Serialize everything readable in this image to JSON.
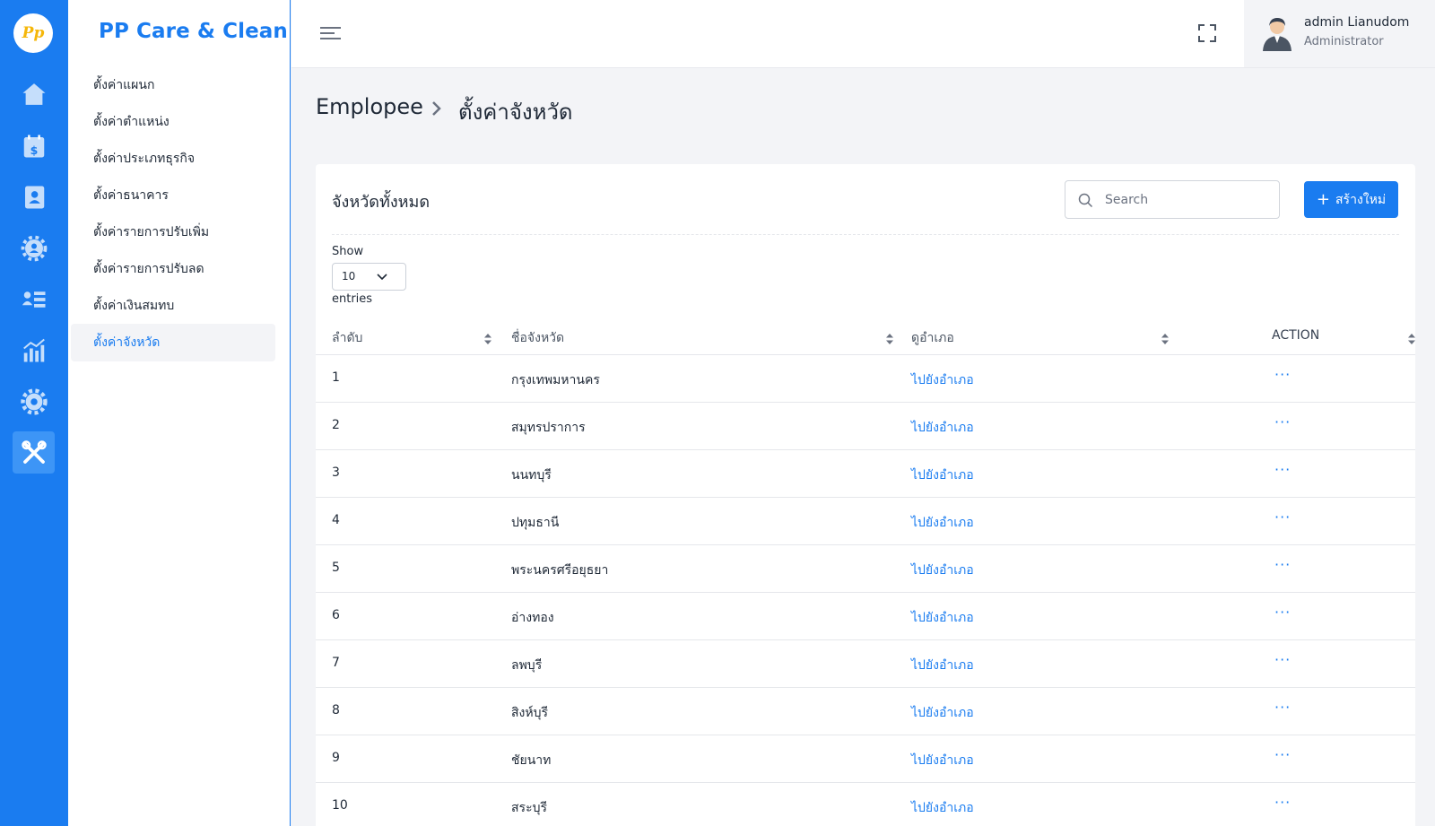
{
  "brand": {
    "logo_text": "Pp",
    "name": "PP Care & Clean"
  },
  "rail": {
    "icons": [
      "home-icon",
      "calendar-dollar-icon",
      "contact-book-icon",
      "team-gear-icon",
      "user-list-icon",
      "bar-chart-icon",
      "settings-gear-icon",
      "tools-icon"
    ],
    "active": "tools-icon"
  },
  "submenu": {
    "items": [
      {
        "label": "ตั้งค่าแผนก"
      },
      {
        "label": "ตั้งค่าตำแหน่ง"
      },
      {
        "label": "ตั้งค่าประเภทธุรกิจ"
      },
      {
        "label": "ตั้งค่าธนาคาร"
      },
      {
        "label": "ตั้งค่ารายการปรับเพิ่ม"
      },
      {
        "label": "ตั้งค่ารายการปรับลด"
      },
      {
        "label": "ตั้งค่าเงินสมทบ"
      },
      {
        "label": "ตั้งค่าจังหวัด"
      }
    ],
    "active_index": 7
  },
  "header": {
    "user_name": "admin Lianudom",
    "user_role": "Administrator"
  },
  "breadcrumb": {
    "parent": "Emplopee",
    "current": "ตั้งค่าจังหวัด"
  },
  "card": {
    "title": "จังหวัดทั้งหมด",
    "search_placeholder": "Search",
    "create_label": "สร้างใหม่",
    "show_label": "Show",
    "page_size": "10",
    "entries_label": "entries"
  },
  "table": {
    "columns": [
      "ลำดับ",
      "ชื่อจังหวัด",
      "ดูอำเภอ",
      "ACTION"
    ],
    "rows": [
      {
        "no": "1",
        "name": "กรุงเทพมหานคร",
        "link": "ไปยังอำเภอ",
        "action": "···"
      },
      {
        "no": "2",
        "name": "สมุทรปราการ",
        "link": "ไปยังอำเภอ",
        "action": "···"
      },
      {
        "no": "3",
        "name": "นนทบุรี",
        "link": "ไปยังอำเภอ",
        "action": "···"
      },
      {
        "no": "4",
        "name": "ปทุมธานี",
        "link": "ไปยังอำเภอ",
        "action": "···"
      },
      {
        "no": "5",
        "name": "พระนครศรีอยุธยา",
        "link": "ไปยังอำเภอ",
        "action": "···"
      },
      {
        "no": "6",
        "name": "อ่างทอง",
        "link": "ไปยังอำเภอ",
        "action": "···"
      },
      {
        "no": "7",
        "name": "ลพบุรี",
        "link": "ไปยังอำเภอ",
        "action": "···"
      },
      {
        "no": "8",
        "name": "สิงห์บุรี",
        "link": "ไปยังอำเภอ",
        "action": "···"
      },
      {
        "no": "9",
        "name": "ชัยนาท",
        "link": "ไปยังอำเภอ",
        "action": "···"
      },
      {
        "no": "10",
        "name": "สระบุรี",
        "link": "ไปยังอำเภอ",
        "action": "···"
      }
    ]
  },
  "colors": {
    "primary": "#1a7cf0",
    "rail_active": "#3d95f6",
    "background": "#f3f4f7",
    "logo_accent": "#f5b70a"
  }
}
